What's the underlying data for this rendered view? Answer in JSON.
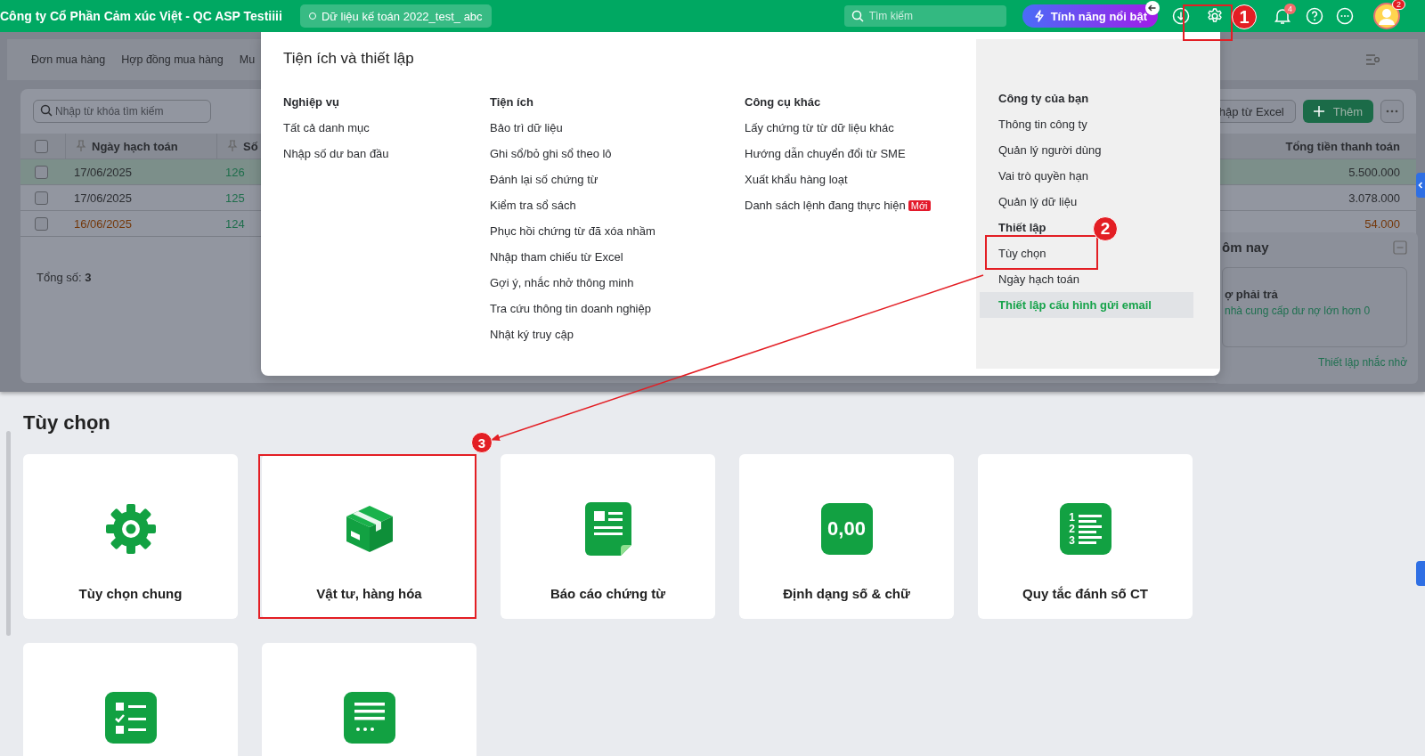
{
  "header": {
    "company": "Công ty Cổ Phần Cảm xúc Việt - QC ASP Testiiii",
    "database": "Dữ liệu kế toán 2022_test_ abc",
    "search": {
      "placeholder": "Tìm kiếm"
    },
    "featured_button": "Tính năng nổi bật",
    "notification_count": "4",
    "avatar_badge": "2"
  },
  "subnav": {
    "tabs": [
      {
        "label": "Đơn mua hàng"
      },
      {
        "label": "Hợp đồng mua hàng"
      },
      {
        "label": "Mu"
      }
    ]
  },
  "list_panel": {
    "search": {
      "placeholder": "Nhập từ khóa tìm kiếm"
    },
    "import_button": "hập từ Excel",
    "add_button": "Thêm",
    "table": {
      "columns": [
        "Ngày hạch toán",
        "Số",
        "Tổng tiền thanh toán"
      ],
      "select_all_checked": false,
      "rows": [
        {
          "date": "17/06/2025",
          "number": "126",
          "total": "5.500.000",
          "selected": true,
          "checked": false,
          "color": "#2b2d31"
        },
        {
          "date": "17/06/2025",
          "number": "125",
          "total": "3.078.000",
          "selected": false,
          "checked": false,
          "color": "#2b2d31"
        },
        {
          "date": "16/06/2025",
          "number": "124",
          "total": "54.000",
          "selected": false,
          "checked": false,
          "color": "#74380a"
        }
      ]
    },
    "total": "Tổng số: **3**"
  },
  "reminder_widget": {
    "title": "ôm nay",
    "item_title": "ợ phải trả",
    "item_text": "nhà cung cấp dư nợ lớn hơn 0",
    "link": "Thiết lập nhắc nhở"
  },
  "popup": {
    "title": "Tiện ích và thiết lập",
    "columns": [
      {
        "heading": "Nghiệp vụ",
        "items": [
          {
            "label": "Tất cả danh mục"
          },
          {
            "label": "Nhập số dư ban đầu"
          }
        ]
      },
      {
        "heading": "Tiện ích",
        "items": [
          {
            "label": "Bảo trì dữ liệu"
          },
          {
            "label": "Ghi sổ/bỏ ghi sổ theo lô"
          },
          {
            "label": "Đánh lại số chứng từ"
          },
          {
            "label": "Kiểm tra sổ sách"
          },
          {
            "label": "Phục hồi chứng từ đã xóa nhầm"
          },
          {
            "label": "Nhập tham chiếu từ Excel"
          },
          {
            "label": "Gợi ý, nhắc nhở thông minh"
          },
          {
            "label": "Tra cứu thông tin doanh nghiệp"
          },
          {
            "label": "Nhật ký truy cập"
          }
        ]
      },
      {
        "heading": "Công cụ khác",
        "items": [
          {
            "label": "Lấy chứng từ từ dữ liệu khác"
          },
          {
            "label": "Hướng dẫn chuyển đổi từ SME"
          },
          {
            "label": "Xuất khẩu hàng loạt"
          },
          {
            "label": "Danh sách lệnh đang thực hiện",
            "badge": "Mới"
          }
        ]
      }
    ],
    "side": [
      {
        "heading": "Công ty của bạn",
        "items": [
          {
            "label": "Thông tin công ty",
            "selected": false
          },
          {
            "label": "Quản lý người dùng",
            "selected": false
          },
          {
            "label": "Vai trò quyền hạn",
            "selected": false
          },
          {
            "label": "Quản lý dữ liệu",
            "selected": false
          }
        ]
      },
      {
        "heading": "Thiết lập",
        "items": [
          {
            "label": "Tùy chọn",
            "selected": false
          },
          {
            "label": "Ngày hạch toán",
            "selected": false
          },
          {
            "label": "Thiết lập cấu hình gửi email",
            "selected": true
          }
        ]
      }
    ]
  },
  "options_page": {
    "title": "Tùy chọn",
    "cards": [
      {
        "kind": "gear",
        "label": "Tùy chọn chung"
      },
      {
        "kind": "box",
        "label": "Vật tư, hàng hóa"
      },
      {
        "kind": "report",
        "label": "Báo cáo chứng từ"
      },
      {
        "kind": "number",
        "icon_text": "0,00",
        "label": "Định dạng số & chữ"
      },
      {
        "kind": "numbering",
        "icon_digits": [
          "1",
          "2",
          "3"
        ],
        "label": "Quy tắc đánh số CT"
      },
      {
        "kind": "checklist"
      },
      {
        "kind": "list"
      }
    ]
  },
  "annotations": {
    "markers": [
      "1",
      "2",
      "3"
    ]
  }
}
